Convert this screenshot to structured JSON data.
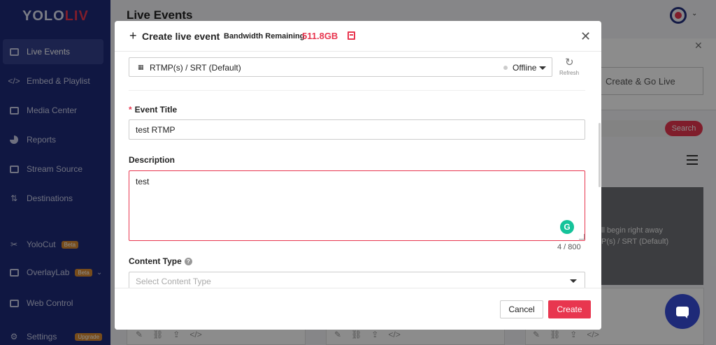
{
  "app": {
    "logo_prefix": "YOLO",
    "logo_suffix": "LIV",
    "page_title": "Live Events"
  },
  "sidebar": {
    "items": [
      {
        "label": "Live Events",
        "icon": "video-camera-icon"
      },
      {
        "label": "Embed & Playlist",
        "icon": "embed-code-icon"
      },
      {
        "label": "Media Center",
        "icon": "media-icon"
      },
      {
        "label": "Reports",
        "icon": "pie-chart-icon"
      },
      {
        "label": "Stream Source",
        "icon": "camera-icon"
      },
      {
        "label": "Destinations",
        "icon": "destinations-icon"
      },
      {
        "label": "YoloCut",
        "icon": "scissors-icon",
        "badge": "Beta"
      },
      {
        "label": "OverlayLab",
        "icon": "overlay-icon",
        "badge": "Beta"
      },
      {
        "label": "Web Control",
        "icon": "web-control-icon"
      },
      {
        "label": "Settings",
        "icon": "gear-icon",
        "badge": "Upgrade"
      }
    ]
  },
  "background": {
    "create_go_live": "Create & Go Live",
    "search_button": "Search",
    "preview_line1": "ll begin right away",
    "preview_line2": "P(s) / SRT (Default)"
  },
  "modal": {
    "title": "Create live event",
    "bandwidth_label": "Bandwidth Remaining",
    "bandwidth_value": "511.8GB",
    "source": {
      "label": "RTMP(s) / SRT (Default)",
      "status": "Offline"
    },
    "refresh_label": "Refresh",
    "event_title": {
      "label": "Event Title",
      "value": "test RTMP"
    },
    "description": {
      "label": "Description",
      "value": "test",
      "counter": "4 / 800"
    },
    "content_type": {
      "label": "Content Type",
      "placeholder": "Select Content Type"
    },
    "footer": {
      "cancel_label": "Cancel",
      "create_label": "Create"
    }
  },
  "colors": {
    "sidebar": "#1e2a78",
    "accent": "#e8364f"
  }
}
